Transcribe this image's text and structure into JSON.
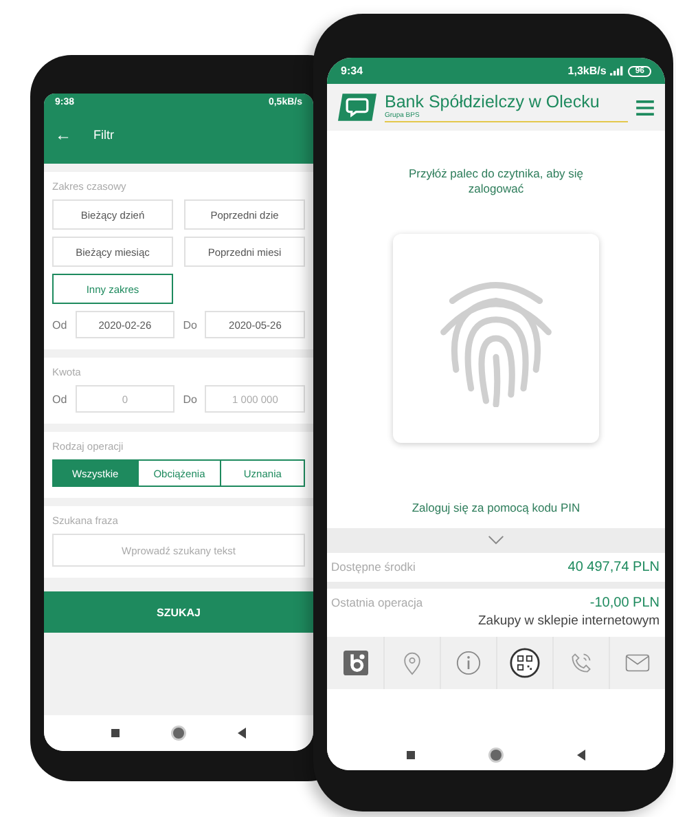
{
  "back_phone": {
    "status_bar": {
      "time": "9:38",
      "speed": "0,5kB/s"
    },
    "header": {
      "back_icon": "←",
      "title": "Filtr"
    },
    "date_range": {
      "label": "Zakres czasowy",
      "options": [
        {
          "label": "Bieżący dzień",
          "selected": false
        },
        {
          "label": "Poprzedni dzie",
          "selected": false
        },
        {
          "label": "Bieżący miesiąc",
          "selected": false
        },
        {
          "label": "Poprzedni miesi",
          "selected": false
        },
        {
          "label": "Inny zakres",
          "selected": true
        }
      ],
      "from_label": "Od",
      "from": "2020-02-26",
      "to_label": "Do",
      "to": "2020-05-26"
    },
    "amount": {
      "label": "Kwota",
      "from_label": "Od",
      "from_placeholder": "0",
      "to_label": "Do",
      "to_placeholder": "1 000 000"
    },
    "operation_type": {
      "label": "Rodzaj operacji",
      "options": [
        {
          "label": "Wszystkie",
          "selected": true
        },
        {
          "label": "Obciążenia",
          "selected": false
        },
        {
          "label": "Uznania",
          "selected": false
        }
      ]
    },
    "search": {
      "label": "Szukana fraza",
      "placeholder": "Wprowadź szukany tekst"
    },
    "search_button": "SZUKAJ"
  },
  "front_phone": {
    "status_bar": {
      "time": "9:34",
      "speed": "1,3kB/s",
      "battery": "96"
    },
    "header": {
      "bank_name": "Bank Spółdzielczy w Olecku",
      "group": "Grupa BPS"
    },
    "prompt": "Przyłóż palec do czytnika, aby się zalogować",
    "pin_link": "Zaloguj się za pomocą kodu PIN",
    "balance": {
      "label": "Dostępne środki",
      "value": "40 497,74 PLN"
    },
    "last_operation": {
      "label": "Ostatnia operacja",
      "amount": "-10,00 PLN",
      "description": "Zakupy w sklepie internetowym"
    }
  }
}
